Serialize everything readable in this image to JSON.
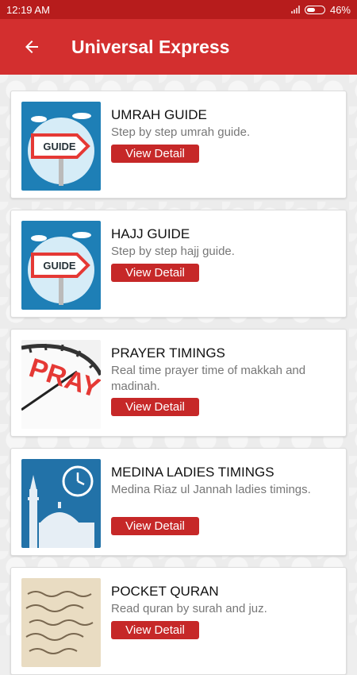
{
  "status_bar": {
    "time": "12:19 AM",
    "battery": "46%"
  },
  "header": {
    "title": "Universal Express"
  },
  "cards": [
    {
      "title": "UMRAH GUIDE",
      "description": "Step by step umrah guide.",
      "button_label": "View Detail",
      "image": "guide-sign"
    },
    {
      "title": "HAJJ GUIDE",
      "description": "Step by step hajj guide.",
      "button_label": "View Detail",
      "image": "guide-sign"
    },
    {
      "title": "PRAYER TIMINGS",
      "description": "Real time prayer time of makkah and madinah.",
      "button_label": "View Detail",
      "image": "clock-pray"
    },
    {
      "title": "MEDINA LADIES TIMINGS",
      "description": "Medina Riaz ul Jannah ladies timings.",
      "button_label": "View Detail",
      "image": "mosque-clock"
    },
    {
      "title": "POCKET QURAN",
      "description": "Read quran by surah and juz.",
      "button_label": "View Detail",
      "image": "quran-page"
    }
  ],
  "colors": {
    "primary": "#d32f2f",
    "status_bar": "#b71c1c",
    "button": "#c62828"
  }
}
